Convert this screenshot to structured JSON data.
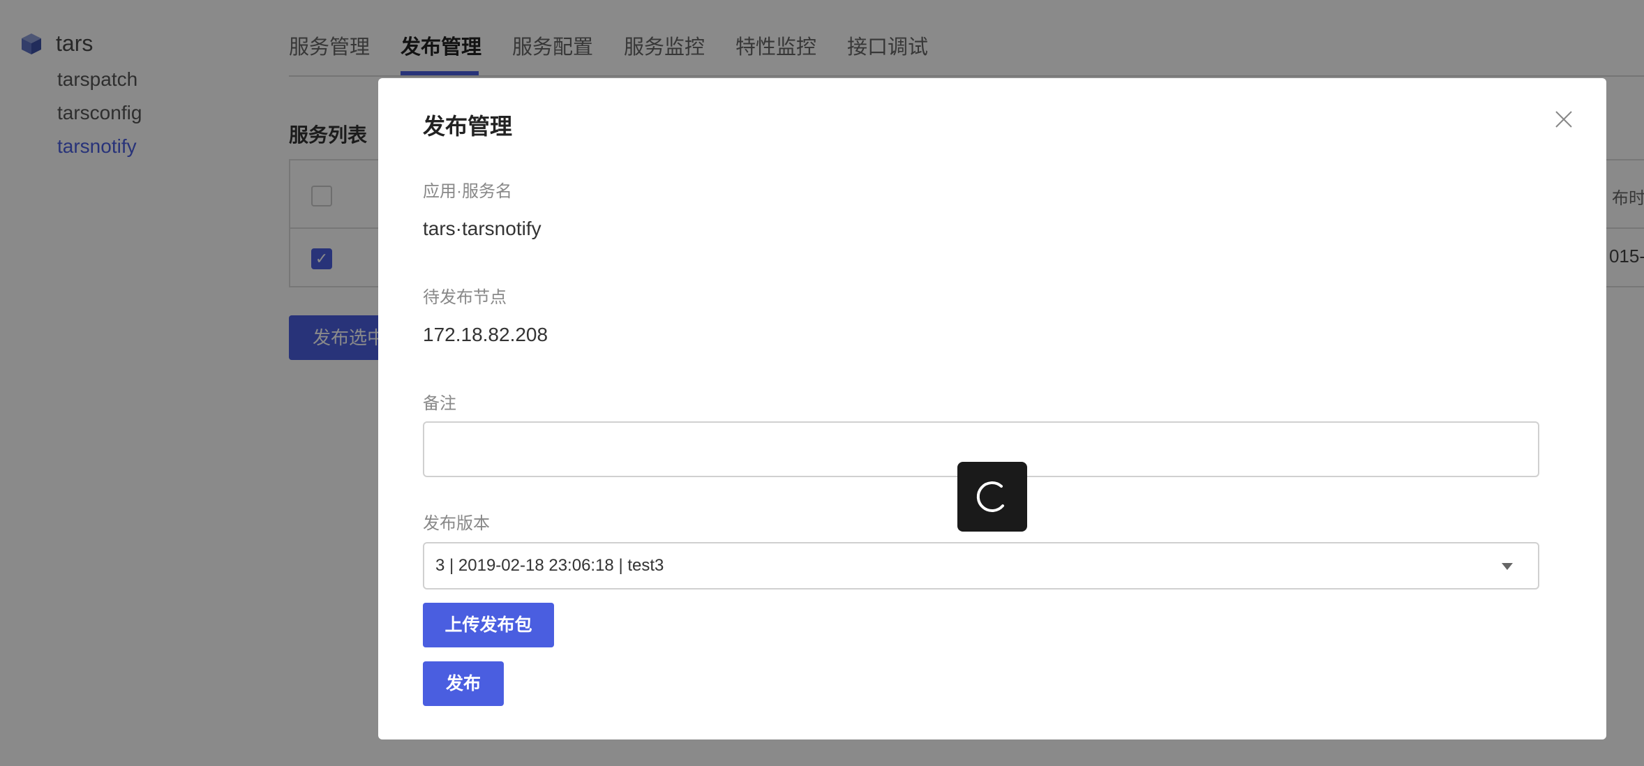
{
  "sidebar": {
    "root": {
      "label": "tars",
      "icon": "cube-icon"
    },
    "items": [
      {
        "label": "tarspatch",
        "active": false
      },
      {
        "label": "tarsconfig",
        "active": false
      },
      {
        "label": "tarsnotify",
        "active": true
      }
    ]
  },
  "tabs": [
    {
      "label": "服务管理",
      "active": false
    },
    {
      "label": "发布管理",
      "active": true
    },
    {
      "label": "服务配置",
      "active": false
    },
    {
      "label": "服务监控",
      "active": false
    },
    {
      "label": "特性监控",
      "active": false
    },
    {
      "label": "接口调试",
      "active": false
    }
  ],
  "background": {
    "section_title": "服务列表",
    "table_header_partial": "布时",
    "table_cell_partial": "015-",
    "publish_selected_button": "发布选中"
  },
  "modal": {
    "title": "发布管理",
    "app_service_label": "应用·服务名",
    "app_service_value": "tars·tarsnotify",
    "nodes_label": "待发布节点",
    "nodes_value": "172.18.82.208",
    "remark_label": "备注",
    "remark_value": "",
    "version_label": "发布版本",
    "version_value": "3 | 2019-02-18 23:06:18 | test3",
    "upload_button": "上传发布包",
    "publish_button": "发布"
  },
  "colors": {
    "accent": "#4a5ee0",
    "overlay": "rgba(0,0,0,0.46)",
    "spinner_bg": "#1a1a1a"
  }
}
